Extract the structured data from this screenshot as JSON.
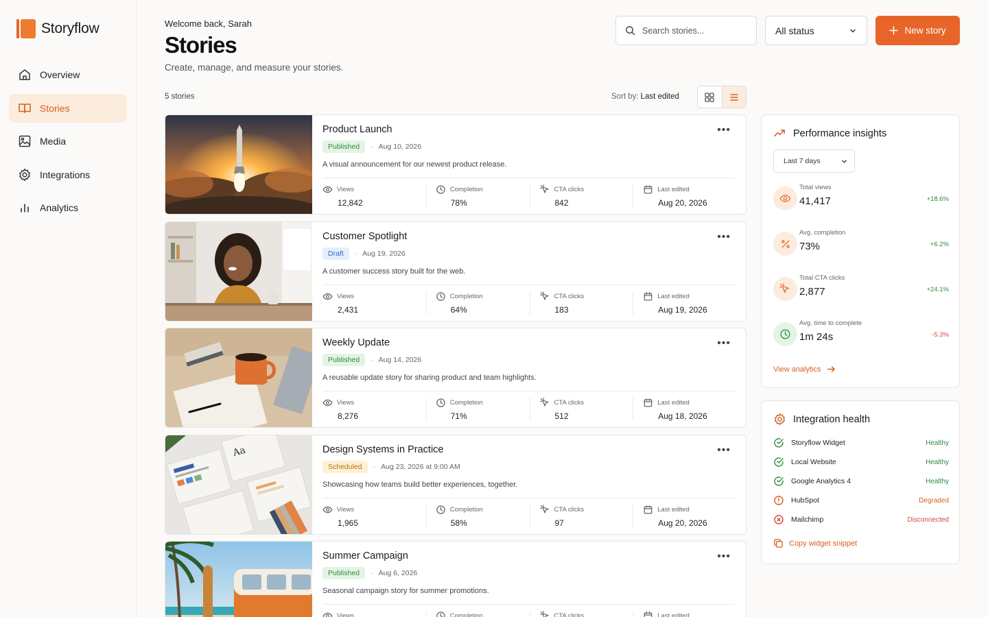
{
  "app": {
    "name": "Storyflow"
  },
  "nav": [
    {
      "label": "Overview",
      "icon": "home-icon"
    },
    {
      "label": "Stories",
      "icon": "book-icon",
      "active": true
    },
    {
      "label": "Media",
      "icon": "image-icon"
    },
    {
      "label": "Integrations",
      "icon": "gear-icon"
    },
    {
      "label": "Analytics",
      "icon": "bar-chart-icon"
    }
  ],
  "header": {
    "welcome": "Welcome back, Sarah",
    "title": "Stories",
    "subtitle": "Create, manage, and measure your stories.",
    "search_placeholder": "Search stories...",
    "status_filter": "All status",
    "new_button": "New story"
  },
  "list": {
    "count": "5 stories",
    "sort_label": "Sort by:",
    "sort_value": "Last edited",
    "view_mode": "list"
  },
  "stat_labels": {
    "views": "Views",
    "completion": "Completion",
    "cta": "CTA clicks",
    "edited": "Last edited"
  },
  "stories": [
    {
      "title": "Product Launch",
      "status": "Published",
      "date": "Aug 10, 2026",
      "description": "A visual announcement for our newest product release.",
      "views": "12,842",
      "completion": "78%",
      "cta": "842",
      "edited": "Aug 20, 2026",
      "image": "rocket-launch"
    },
    {
      "title": "Customer Spotlight",
      "status": "Draft",
      "date": "Aug 19, 2026",
      "description": "A customer success story built for the web.",
      "views": "2,431",
      "completion": "64%",
      "cta": "183",
      "edited": "Aug 19, 2026",
      "image": "smiling-woman-at-desk"
    },
    {
      "title": "Weekly Update",
      "status": "Published",
      "date": "Aug 14, 2026",
      "description": "A reusable update story for sharing product and team highlights.",
      "views": "8,276",
      "completion": "71%",
      "cta": "512",
      "edited": "Aug 18, 2026",
      "image": "coffee-mug-and-notebook"
    },
    {
      "title": "Design Systems in Practice",
      "status": "Scheduled",
      "date": "Aug 23, 2026 at 9:00 AM",
      "description": "Showcasing how teams build better experiences, together.",
      "views": "1,965",
      "completion": "58%",
      "cta": "97",
      "edited": "Aug 20, 2026",
      "image": "design-system-cards"
    },
    {
      "title": "Summer Campaign",
      "status": "Published",
      "date": "Aug 6, 2026",
      "description": "Seasonal campaign story for summer promotions.",
      "views": "",
      "completion": "",
      "cta": "",
      "edited": "",
      "image": "beach-van-surfboard"
    }
  ],
  "insights": {
    "title": "Performance insights",
    "range": "Last 7 days",
    "metrics": [
      {
        "label": "Total views",
        "value": "41,417",
        "delta": "+18.6%",
        "trend": "up",
        "icon": "eye-icon"
      },
      {
        "label": "Avg. completion",
        "value": "73%",
        "delta": "+6.2%",
        "trend": "up",
        "icon": "percent-icon"
      },
      {
        "label": "Total CTA clicks",
        "value": "2,877",
        "delta": "+24.1%",
        "trend": "up",
        "icon": "cursor-click-icon"
      },
      {
        "label": "Avg. time to complete",
        "value": "1m 24s",
        "delta": "-5.3%",
        "trend": "down",
        "icon": "clock-icon"
      }
    ],
    "link": "View analytics"
  },
  "integrations": {
    "title": "Integration health",
    "items": [
      {
        "name": "Storyflow Widget",
        "status": "Healthy"
      },
      {
        "name": "Local Website",
        "status": "Healthy"
      },
      {
        "name": "Google Analytics 4",
        "status": "Healthy"
      },
      {
        "name": "HubSpot",
        "status": "Degraded"
      },
      {
        "name": "Mailchimp",
        "status": "Disconnected"
      }
    ],
    "link": "Copy widget snippet"
  },
  "colors": {
    "accent": "#e8652a",
    "accent_soft": "#fcecde",
    "healthy": "#2e8b3a",
    "degraded": "#d4601f",
    "disconnected": "#d04a3a"
  }
}
